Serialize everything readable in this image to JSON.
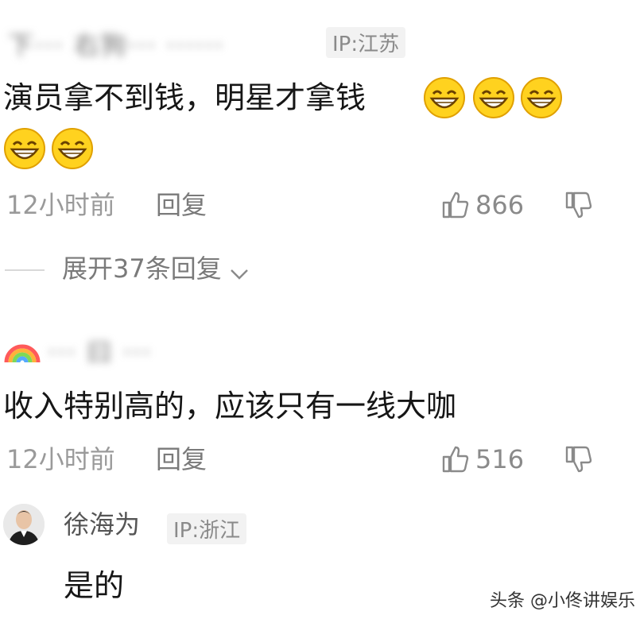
{
  "comment1": {
    "username": "下··· 右狗··· ······",
    "ip": "IP:江苏",
    "text": "演员拿不到钱，明星才拿钱",
    "time": "12小时前",
    "reply": "回复",
    "likes": "866",
    "emoji_icon": "grinning-face-icon"
  },
  "expand": {
    "label": "展开37条回复"
  },
  "comment2": {
    "username": "··· 曰 ···",
    "text": "收入特别高的，应该只有一线大咖",
    "time": "12小时前",
    "reply": "回复",
    "likes": "516"
  },
  "comment3": {
    "username": "徐海为",
    "ip": "IP:浙江",
    "text": "是的"
  },
  "watermark": {
    "text": "头条 @小佟讲娱乐"
  },
  "colors": {
    "text": "#161616",
    "meta": "#9a9a9a",
    "emoji_face": "#ffd21f",
    "emoji_outline": "#e0a000"
  }
}
